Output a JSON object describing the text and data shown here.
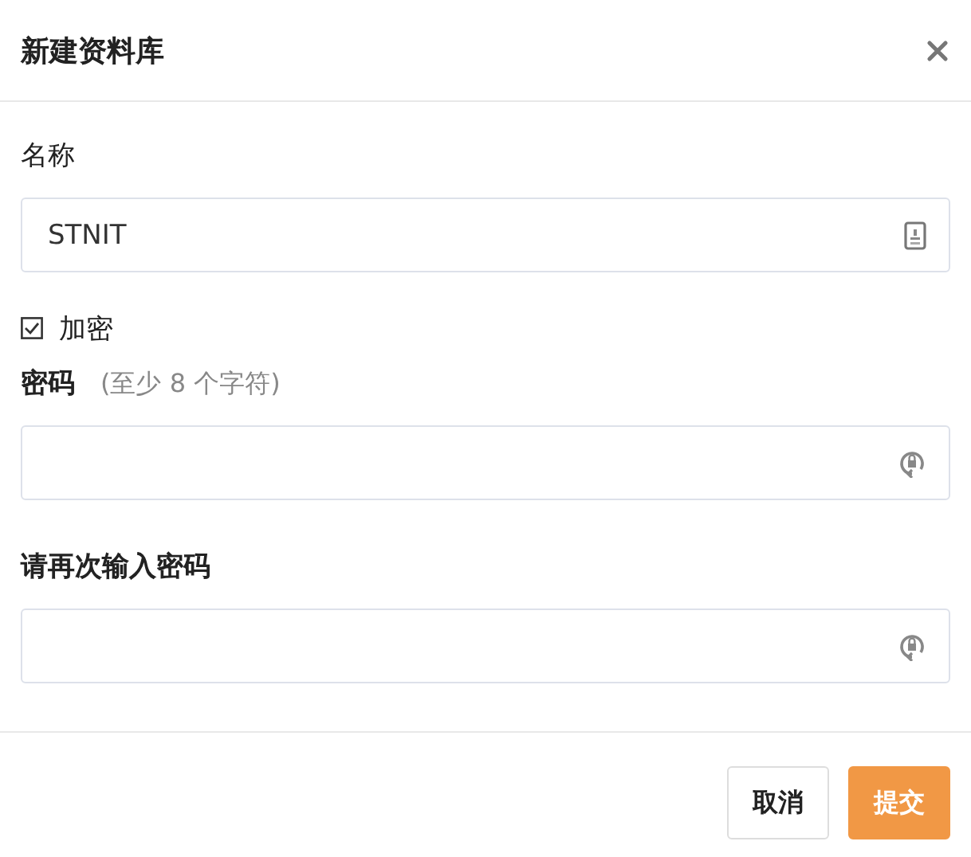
{
  "dialog": {
    "title": "新建资料库"
  },
  "name_field": {
    "label": "名称",
    "value": "STNIT"
  },
  "encrypt": {
    "label": "加密",
    "checked": true
  },
  "password_field": {
    "label": "密码",
    "hint": "(至少 8 个字符)"
  },
  "confirm_field": {
    "label": "请再次输入密码"
  },
  "buttons": [
    {
      "label": "取消",
      "kind": "secondary"
    },
    {
      "label": "提交",
      "kind": "primary"
    }
  ]
}
